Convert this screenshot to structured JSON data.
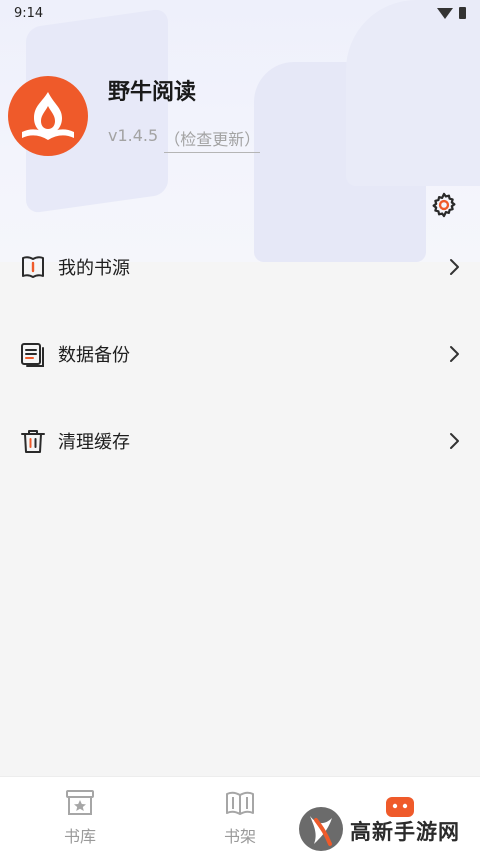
{
  "status_bar": {
    "time": "9:14"
  },
  "profile": {
    "app_name": "野牛阅读",
    "version": "v1.4.5",
    "update_check": "（检查更新）"
  },
  "menu": [
    {
      "label": "我的书源",
      "icon": "book-source-icon"
    },
    {
      "label": "数据备份",
      "icon": "backup-icon"
    },
    {
      "label": "清理缓存",
      "icon": "trash-icon"
    }
  ],
  "bottom_nav": {
    "tabs": [
      {
        "label": "书库",
        "icon": "library-icon"
      },
      {
        "label": "书架",
        "icon": "bookshelf-icon"
      },
      {
        "label": "",
        "icon": "profile-icon"
      }
    ]
  },
  "watermark": {
    "text": "高新手游网"
  },
  "colors": {
    "accent": "#ef5a2a",
    "header_bg": "#eef0fb",
    "page_bg": "#f5f5f5"
  }
}
